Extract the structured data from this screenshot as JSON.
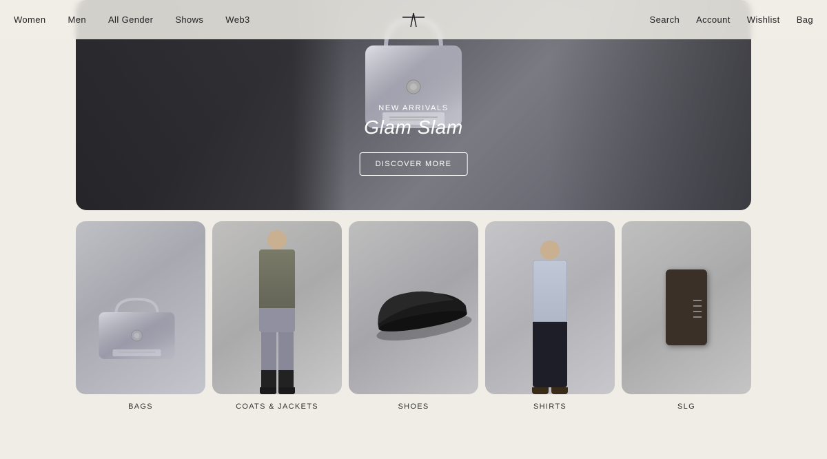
{
  "nav": {
    "left": [
      {
        "label": "Women",
        "id": "women"
      },
      {
        "label": "Men",
        "id": "men"
      },
      {
        "label": "All Gender",
        "id": "all-gender"
      },
      {
        "label": "Shows",
        "id": "shows"
      },
      {
        "label": "Web3",
        "id": "web3"
      }
    ],
    "right": [
      {
        "label": "Search",
        "id": "search"
      },
      {
        "label": "Account",
        "id": "account"
      },
      {
        "label": "Wishlist",
        "id": "wishlist"
      },
      {
        "label": "Bag",
        "id": "bag"
      }
    ]
  },
  "hero": {
    "label": "NEW ARRIVALS",
    "title": "Glam Slam",
    "button": "DISCOVER MORE"
  },
  "categories": [
    {
      "id": "bags",
      "label": "BAGS"
    },
    {
      "id": "coats-jackets",
      "label": "COATS & JACKETS"
    },
    {
      "id": "shoes",
      "label": "SHOES"
    },
    {
      "id": "shirts",
      "label": "SHIRTS"
    },
    {
      "id": "slg",
      "label": "SLG"
    }
  ],
  "colors": {
    "bg": "#f0ede6",
    "nav_bg": "rgba(240,237,230,0.85)",
    "text": "#222222",
    "hero_text": "#ffffff"
  }
}
